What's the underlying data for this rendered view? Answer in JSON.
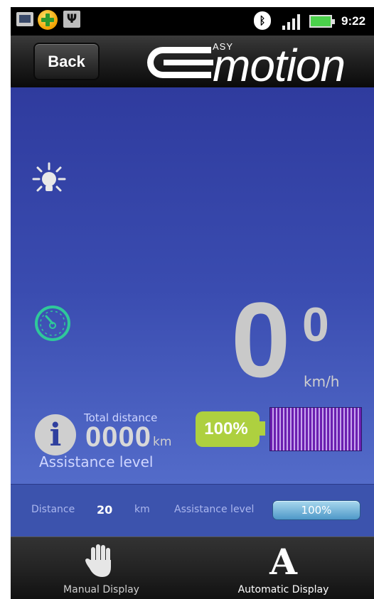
{
  "status_bar": {
    "time": "9:22",
    "icons": [
      "mail-icon",
      "plus-app-icon",
      "usb-icon",
      "bluetooth-icon",
      "signal-icon",
      "battery-charging-icon"
    ]
  },
  "header": {
    "back_label": "Back",
    "logo_small": "ASY",
    "logo_main": "motion"
  },
  "dashboard": {
    "light_icon": "light-bulb-icon",
    "speedometer_icon": "speedometer-icon",
    "speed_value": "0",
    "speed_super": "0",
    "speed_unit": "km/h",
    "info_symbol": "i",
    "total_distance_label": "Total distance",
    "total_distance_value": "0000",
    "total_distance_unit": "km",
    "battery_percent_label": "100%",
    "assistance_bar_level": 1.0,
    "assistance_title": "Assistance level"
  },
  "settings": {
    "distance_label": "Distance",
    "distance_value": "20",
    "distance_unit": "km",
    "assistance_label": "Assistance level",
    "assistance_value": "100%"
  },
  "bottom_nav": {
    "manual_label": "Manual Display",
    "auto_label": "Automatic Display",
    "auto_glyph": "A"
  },
  "colors": {
    "main_bg_top": "#2f3b9e",
    "main_bg_bottom": "#5a74d0",
    "battery_green": "#aed03f",
    "assist_bar_purple": "#7b2fb8",
    "speedo_green": "#2fc89a"
  }
}
